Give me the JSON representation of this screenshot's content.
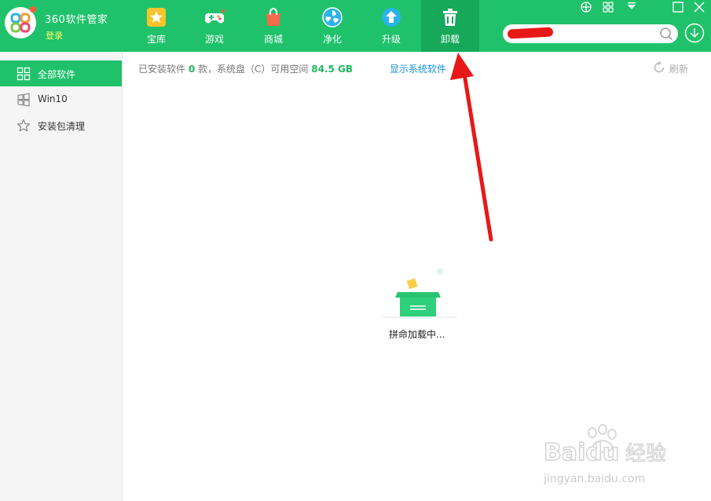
{
  "header": {
    "app_title": "360软件管家",
    "login_label": "登录",
    "tabs": [
      {
        "label": "宝库",
        "icon": "star-icon"
      },
      {
        "label": "游戏",
        "icon": "gamepad-icon"
      },
      {
        "label": "商城",
        "icon": "shopping-bag-icon"
      },
      {
        "label": "净化",
        "icon": "fan-icon"
      },
      {
        "label": "升级",
        "icon": "upgrade-arrow-icon"
      },
      {
        "label": "卸载",
        "icon": "trash-icon"
      }
    ],
    "active_tab": "卸载",
    "search": {
      "value": "",
      "placeholder": ""
    }
  },
  "window_controls": [
    "grid-icon",
    "skin-icon",
    "menu-down-icon",
    "maximize-icon",
    "close-icon"
  ],
  "sidebar": {
    "items": [
      {
        "label": "全部软件",
        "icon": "grid-icon",
        "active": true
      },
      {
        "label": "Win10",
        "icon": "windows-icon",
        "active": false
      },
      {
        "label": "安装包清理",
        "icon": "star-outline-icon",
        "active": false
      }
    ]
  },
  "main": {
    "info": {
      "prefix": "已安装软件",
      "count": "0",
      "middle": "款，系统盘（C）可用空间",
      "free_space": "84.5 GB"
    },
    "show_system_link": "显示系统软件",
    "refresh_label": "刷新",
    "loading_text": "拼命加载中..."
  },
  "watermark": {
    "brand": "Baidu",
    "sub": "经验",
    "url": "jingyan.baidu.com"
  },
  "colors": {
    "brand_green": "#1fc26a",
    "active_tab_green": "#17a95a",
    "link_blue": "#1a8fd8",
    "annotation_red": "#e81818"
  }
}
